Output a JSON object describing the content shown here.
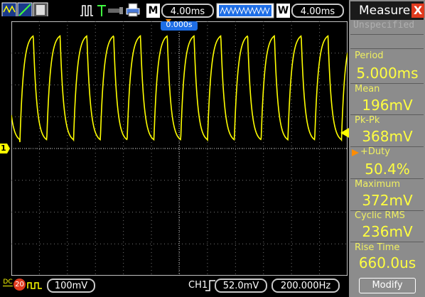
{
  "topbar": {
    "mode_label": "M",
    "main_timebase": "4.00ms",
    "window_label": "W",
    "window_timebase": "4.00ms",
    "trigger_marker": "0.000s"
  },
  "channel": {
    "marker": "1",
    "coupling": "DC",
    "bandwidth_limit": "20",
    "volts_per_div": "100mV"
  },
  "trigger": {
    "source": "CH1",
    "level": "52.0mV",
    "frequency": "200.000Hz"
  },
  "measure_panel": {
    "title": "Measure",
    "close_label": "X",
    "unspecified_label": "Unspecified",
    "items": [
      {
        "label": "Period",
        "value": "5.000ms"
      },
      {
        "label": "Mean",
        "value": "196mV"
      },
      {
        "label": "Pk-Pk",
        "value": "368mV"
      },
      {
        "label": "+Duty",
        "value": "50.4%"
      },
      {
        "label": "Maximum",
        "value": "372mV"
      },
      {
        "label": "Cyclic RMS",
        "value": "236mV"
      },
      {
        "label": "Rise Time",
        "value": "660.0us"
      }
    ],
    "modify_label": "Modify"
  },
  "colors": {
    "trace": "#ffff00",
    "marker_orange": "#ff8c00",
    "panel_bg": "#8c8c8c",
    "accent_blue": "#1e6ee6"
  },
  "icons": {
    "run_icon": "waveform-icon",
    "trigger_icon": "trigger-edge-icon",
    "usb_icon": "usb-icon",
    "printer_icon": "printer-icon"
  }
}
